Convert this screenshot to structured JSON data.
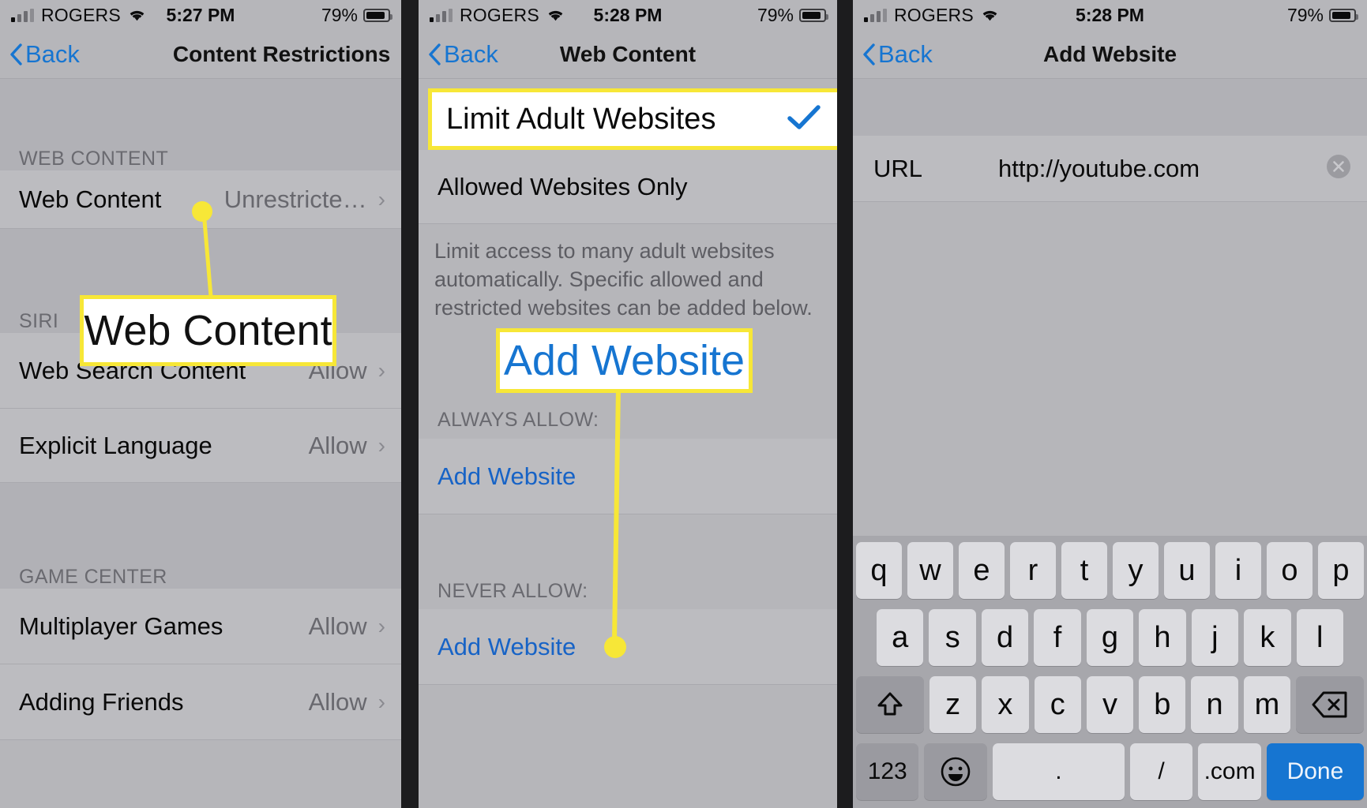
{
  "panel1": {
    "status": {
      "carrier": "ROGERS",
      "time": "5:27 PM",
      "battery": "79%"
    },
    "nav": {
      "back": "Back",
      "title": "Content Restrictions"
    },
    "sections": [
      {
        "header": "WEB CONTENT",
        "rows": [
          {
            "label": "Web Content",
            "value": "Unrestricte…",
            "disclosure": true
          }
        ]
      },
      {
        "header": "SIRI",
        "rows": [
          {
            "label": "Web Search Content",
            "value": "Allow",
            "disclosure": true
          },
          {
            "label": "Explicit Language",
            "value": "Allow",
            "disclosure": true
          }
        ]
      },
      {
        "header": "GAME CENTER",
        "rows": [
          {
            "label": "Multiplayer Games",
            "value": "Allow",
            "disclosure": true
          },
          {
            "label": "Adding Friends",
            "value": "Allow",
            "disclosure": true
          }
        ]
      }
    ],
    "callout": {
      "text": "Web Content"
    }
  },
  "panel2": {
    "status": {
      "carrier": "ROGERS",
      "time": "5:28 PM",
      "battery": "79%"
    },
    "nav": {
      "back": "Back",
      "title": "Web Content"
    },
    "options": [
      {
        "label": "Limit Adult Websites",
        "checked": true
      },
      {
        "label": "Allowed Websites Only",
        "checked": false
      }
    ],
    "description": "Limit access to many adult websites automatically. Specific allowed and restricted websites can be added below.",
    "always_allow": {
      "header": "ALWAYS ALLOW:",
      "action": "Add Website"
    },
    "never_allow": {
      "header": "NEVER ALLOW:",
      "action": "Add Website"
    },
    "callout": {
      "text": "Add Website"
    }
  },
  "panel3": {
    "status": {
      "carrier": "ROGERS",
      "time": "5:28 PM",
      "battery": "79%"
    },
    "nav": {
      "back": "Back",
      "title": "Add Website"
    },
    "field": {
      "label": "URL",
      "value": "http://youtube.com",
      "clear_icon": "clear-circle-icon"
    },
    "keyboard": {
      "row1": [
        "q",
        "w",
        "e",
        "r",
        "t",
        "y",
        "u",
        "i",
        "o",
        "p"
      ],
      "row2": [
        "a",
        "s",
        "d",
        "f",
        "g",
        "h",
        "j",
        "k",
        "l"
      ],
      "row3_shift": "shift-icon",
      "row3": [
        "z",
        "x",
        "c",
        "v",
        "b",
        "n",
        "m"
      ],
      "row3_backspace": "backspace-icon",
      "row4_numbers": "123",
      "row4_emoji": "emoji-icon",
      "row4": [
        ".",
        "/",
        ".com"
      ],
      "row4_done": "Done"
    }
  },
  "colors": {
    "highlight": "#f7e737",
    "link": "#1675d1",
    "accent_check": "#1675d1"
  }
}
